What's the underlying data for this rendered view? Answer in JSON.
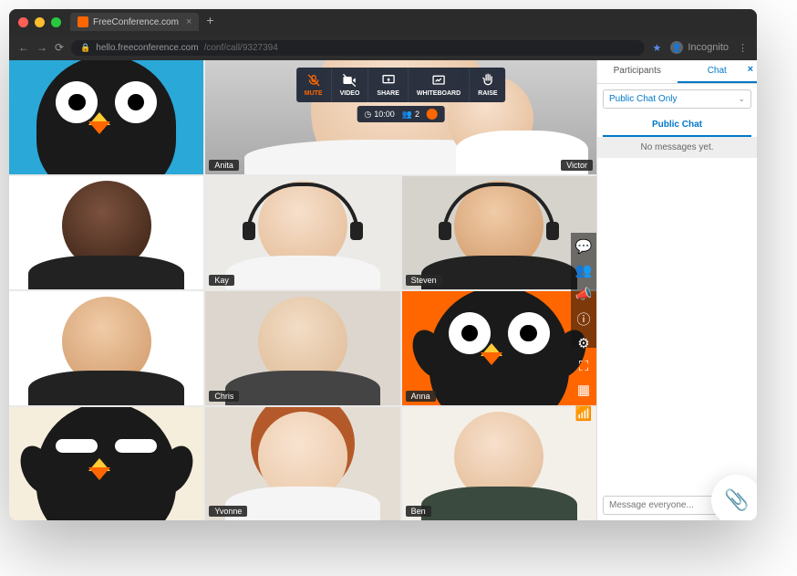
{
  "browser": {
    "tab_title": "FreeConference.com",
    "url_host": "hello.freeconference.com",
    "url_path": "/conf/call/9327394",
    "incognito_label": "Incognito"
  },
  "toolbar": {
    "mute": "MUTE",
    "video": "VIDEO",
    "share": "SHARE",
    "whiteboard": "WHITEBOARD",
    "raise": "RAISE"
  },
  "status": {
    "timer": "10:00",
    "participants_count": "2"
  },
  "tiles": [
    {
      "name": ""
    },
    {
      "name": "Anita"
    },
    {
      "name": "Victor"
    },
    {
      "name": ""
    },
    {
      "name": "Kay"
    },
    {
      "name": "Steven"
    },
    {
      "name": ""
    },
    {
      "name": "Chris"
    },
    {
      "name": "Anna"
    },
    {
      "name": ""
    },
    {
      "name": "Yvonne"
    },
    {
      "name": "Ben"
    }
  ],
  "rail_icons": [
    "chat-icon",
    "participants-icon",
    "megaphone-icon",
    "info-icon",
    "settings-icon",
    "fullscreen-icon",
    "layout-icon",
    "connection-icon"
  ],
  "chat": {
    "tab_participants": "Participants",
    "tab_chat": "Chat",
    "filter": "Public Chat Only",
    "header": "Public Chat",
    "empty": "No messages yet.",
    "placeholder": "Message everyone..."
  }
}
